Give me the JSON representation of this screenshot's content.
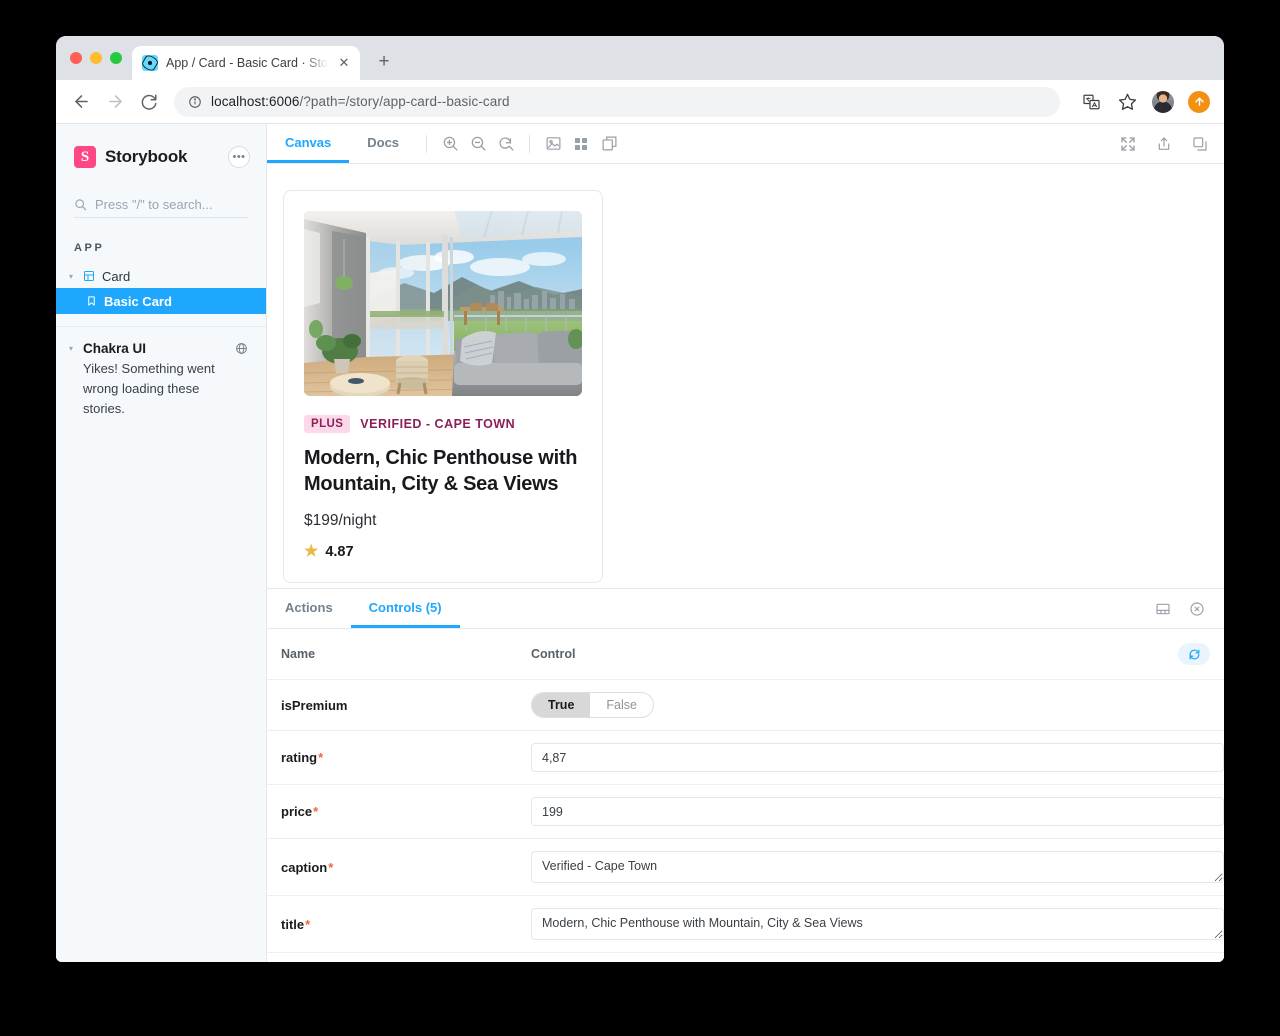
{
  "browser": {
    "tab_title": "App / Card - Basic Card · Story",
    "url_host": "localhost:6006",
    "url_path": "/?path=/story/app-card--basic-card",
    "new_tab_label": "+",
    "close_tab_label": "✕"
  },
  "sidebar": {
    "brand": "Storybook",
    "more_label": "•••",
    "search_placeholder": "Press \"/\" to search...",
    "section_label": "APP",
    "items": [
      {
        "label": "Card",
        "icon": "component-icon",
        "level": 1
      },
      {
        "label": "Basic Card",
        "icon": "bookmark-icon",
        "level": 2,
        "selected": true
      }
    ],
    "error_group": {
      "title": "Chakra UI",
      "message": "Yikes! Something went wrong loading these stories."
    }
  },
  "toolbar": {
    "tabs": [
      {
        "label": "Canvas",
        "active": true
      },
      {
        "label": "Docs",
        "active": false
      }
    ],
    "icons": [
      "zoom-in-icon",
      "zoom-out-icon",
      "zoom-reset-icon",
      "background-icon",
      "grid-icon",
      "measure-icon"
    ],
    "right_icons": [
      "fullscreen-icon",
      "open-in-new-icon",
      "copy-link-icon"
    ]
  },
  "card": {
    "badge": "PLUS",
    "caption": "VERIFIED - CAPE TOWN",
    "title": "Modern, Chic Penthouse with Mountain, City & Sea Views",
    "price": "$199/night",
    "rating": "4.87",
    "star": "★",
    "photo_alt": "penthouse-living-room-photo"
  },
  "panel": {
    "tabs": [
      {
        "label": "Actions",
        "active": false
      },
      {
        "label": "Controls (5)",
        "active": true
      }
    ],
    "right_icons": [
      "panel-position-icon",
      "close-panel-icon"
    ],
    "columns": {
      "name": "Name",
      "control": "Control"
    },
    "reset_icon": "reset-controls-icon",
    "rows": [
      {
        "name": "isPremium",
        "required": false,
        "type": "boolean",
        "value": "True",
        "options": [
          "True",
          "False"
        ]
      },
      {
        "name": "rating",
        "required": true,
        "type": "text",
        "value": "4,87"
      },
      {
        "name": "price",
        "required": true,
        "type": "text",
        "value": "199"
      },
      {
        "name": "caption",
        "required": true,
        "type": "textarea",
        "value": "Verified - Cape Town"
      },
      {
        "name": "title",
        "required": true,
        "type": "textarea",
        "value": "Modern, Chic Penthouse with Mountain, City & Sea Views"
      }
    ]
  },
  "colors": {
    "accent": "#1ea7fd",
    "brand_pink": "#ff4785",
    "badge_bg": "#fbd9e8",
    "badge_text": "#8c1f5a",
    "required": "#f2643b",
    "star": "#eab942"
  }
}
